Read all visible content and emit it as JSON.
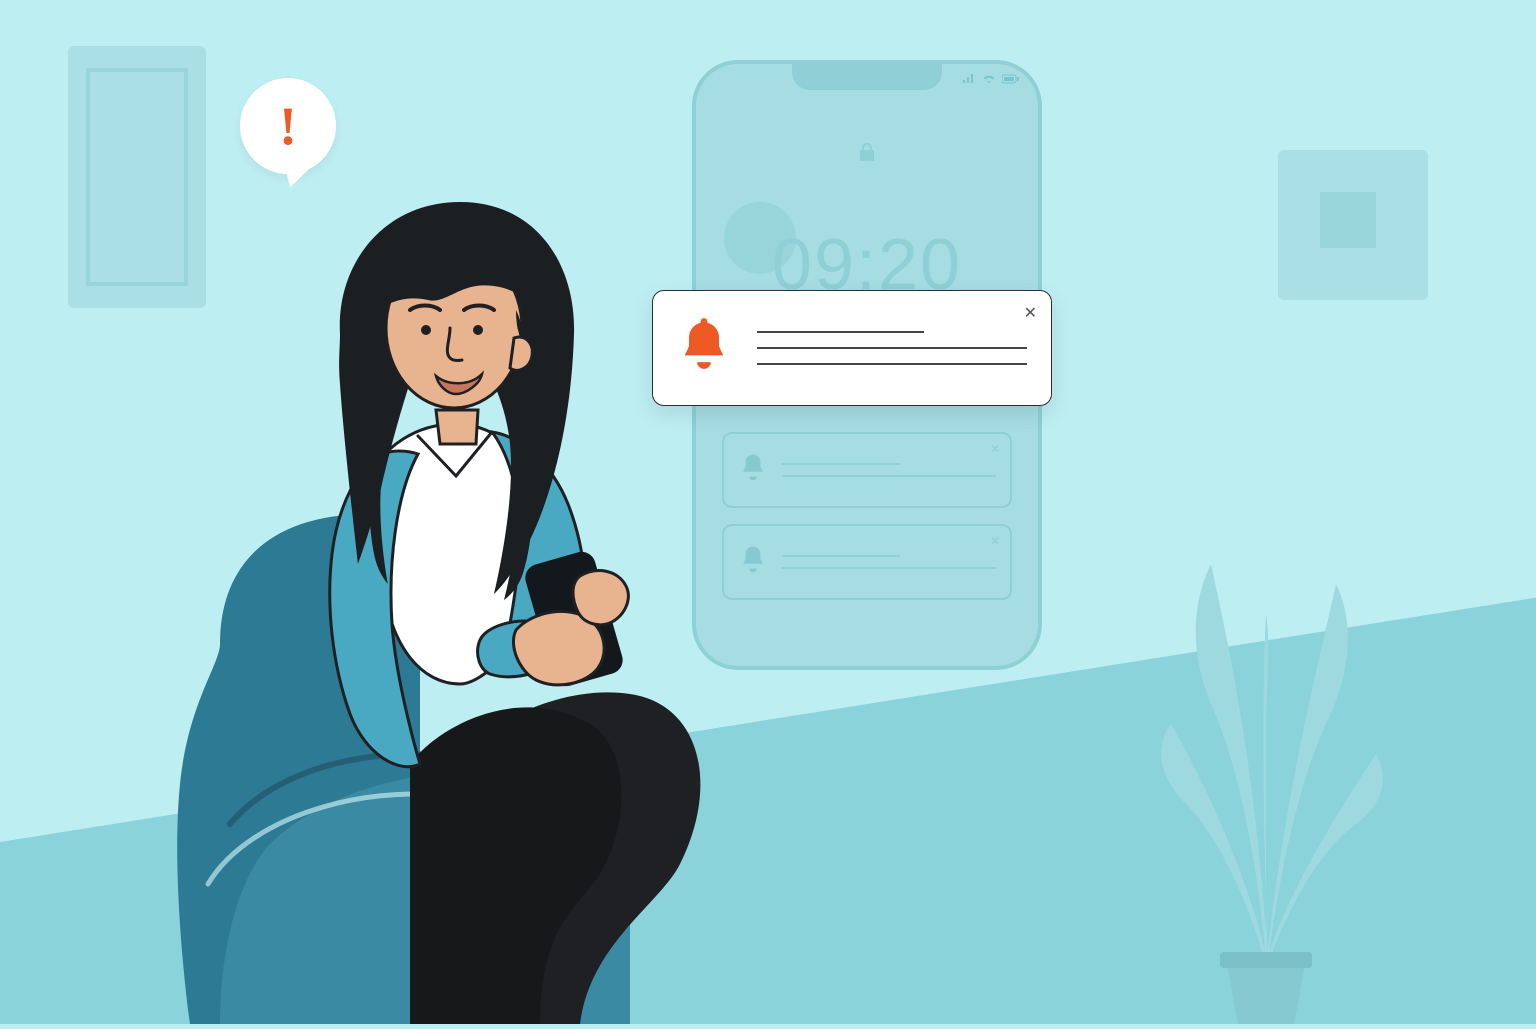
{
  "phone": {
    "time": "09:20"
  },
  "bubble": {
    "mark": "!"
  },
  "colors": {
    "accent": "#ee5a24",
    "bg": "#bdeef2",
    "floor": "#8ad3db"
  }
}
